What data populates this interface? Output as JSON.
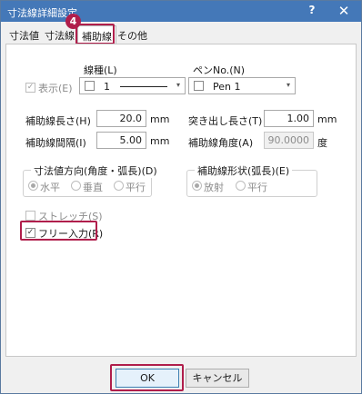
{
  "window": {
    "title": "寸法線詳細設定",
    "help_glyph": "?",
    "close_glyph": "✕"
  },
  "tabs": [
    {
      "label": "寸法値"
    },
    {
      "label": "寸法線"
    },
    {
      "label": "補助線",
      "active": true
    },
    {
      "label": "その他"
    }
  ],
  "callout": {
    "number": "4",
    "color": "#b01e4b"
  },
  "display": {
    "label": "表示(E)",
    "checked": true,
    "enabled": false
  },
  "linetype": {
    "label": "線種(L)",
    "value": "1",
    "arrow": "▾"
  },
  "pen": {
    "label": "ペンNo.(N)",
    "value": "Pen 1",
    "arrow": "▾"
  },
  "fields": {
    "aux_length": {
      "label": "補助線長さ(H)",
      "value": "20.0",
      "unit": "mm"
    },
    "aux_spacing": {
      "label": "補助線間隔(I)",
      "value": "5.00",
      "unit": "mm"
    },
    "overhang": {
      "label": "突き出し長さ(T)",
      "value": "1.00",
      "unit": "mm"
    },
    "aux_angle": {
      "label": "補助線角度(A)",
      "value": "90.0000",
      "unit": "度",
      "enabled": false
    }
  },
  "direction_group": {
    "title": "寸法値方向(角度・弧長)(D)",
    "options": [
      {
        "label": "水平",
        "selected": true
      },
      {
        "label": "垂直",
        "selected": false
      },
      {
        "label": "平行",
        "selected": false
      }
    ]
  },
  "shape_group": {
    "title": "補助線形状(弧長)(E)",
    "options": [
      {
        "label": "放射",
        "selected": true
      },
      {
        "label": "平行",
        "selected": false
      }
    ]
  },
  "stretch": {
    "label": "ストレッチ(S)",
    "checked": false,
    "enabled": false
  },
  "free_input": {
    "label": "フリー入力(R)",
    "checked": true
  },
  "buttons": {
    "ok": "OK",
    "cancel": "キャンセル"
  },
  "colors": {
    "titlebar": "#4478b8",
    "highlight": "#b01e4b"
  }
}
